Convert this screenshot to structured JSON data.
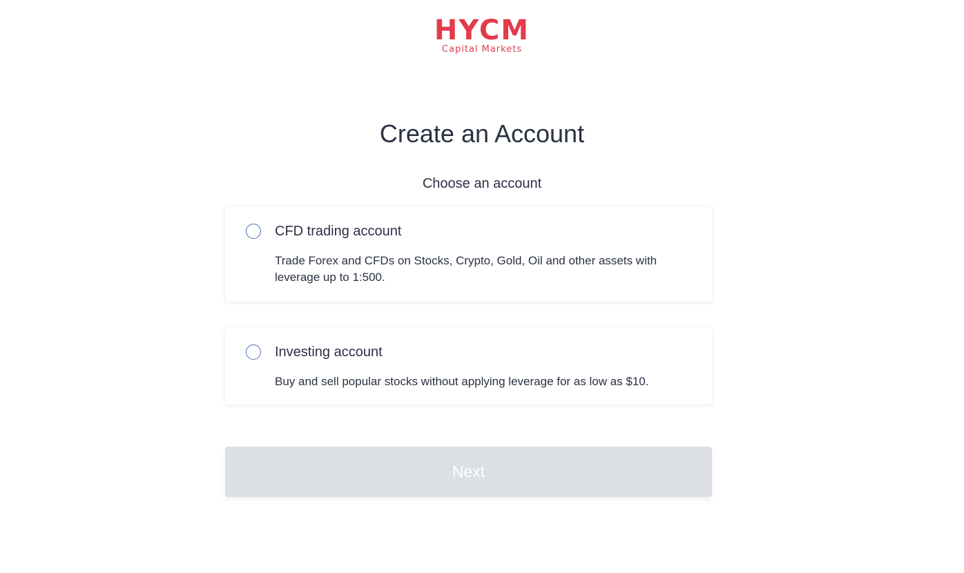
{
  "logo": {
    "mark": "HYCM",
    "subtitle": "Capital Markets"
  },
  "page_title": "Create an Account",
  "subtitle": "Choose an account",
  "accounts": [
    {
      "title": "CFD trading account",
      "description": "Trade Forex and CFDs on Stocks, Crypto, Gold, Oil and other assets with leverage up to 1:500.",
      "selected": false
    },
    {
      "title": "Investing account",
      "description": "Buy and sell popular stocks without applying leverage for as low as $10.",
      "selected": false
    }
  ],
  "next_button": {
    "label": "Next",
    "disabled": true
  },
  "colors": {
    "brand": "#e33b4b",
    "text": "#2a3142",
    "radio_border": "#4e6db5",
    "button_disabled_bg": "#dcdfe4",
    "button_text": "#ffffff"
  }
}
